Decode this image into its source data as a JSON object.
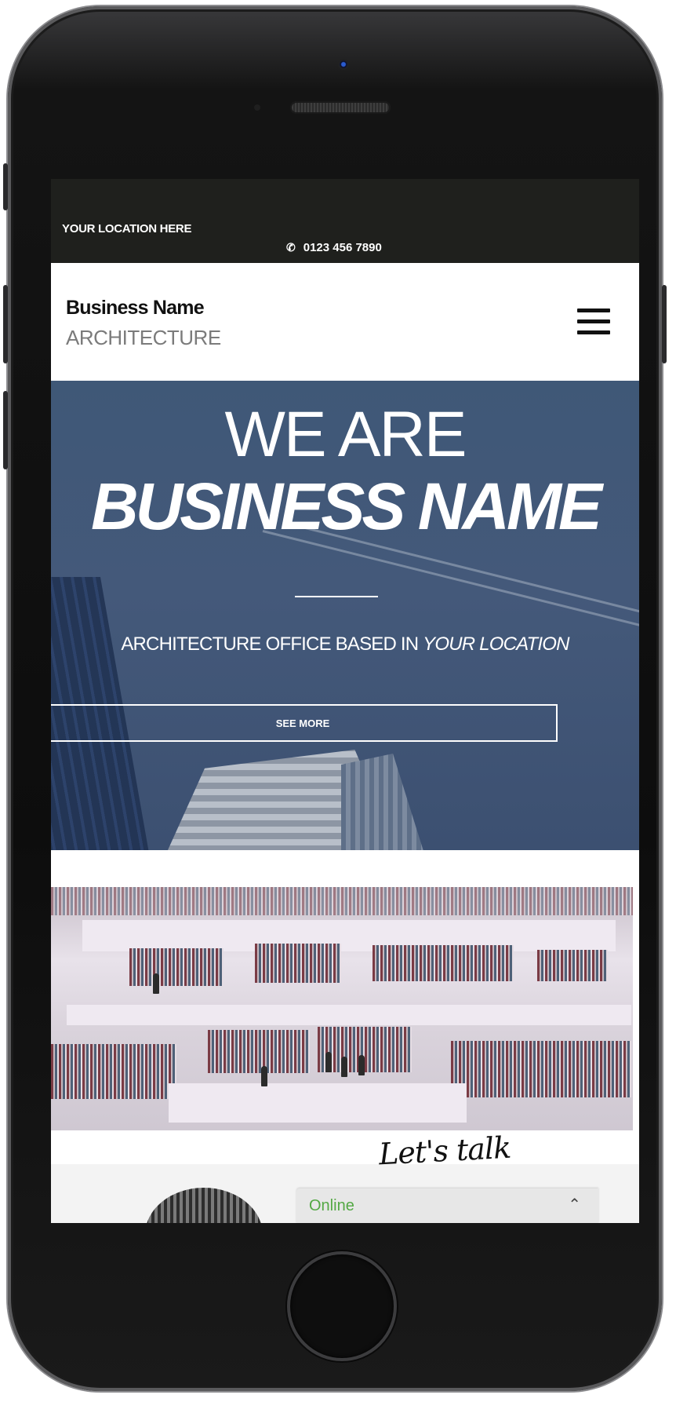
{
  "topbar": {
    "location": "YOUR LOCATION HERE",
    "phone_icon": "phone-icon",
    "phone": "0123 456 7890"
  },
  "header": {
    "brand_name": "Business Name",
    "brand_sub": "ARCHITECTURE",
    "menu_icon": "hamburger-menu-icon"
  },
  "hero": {
    "line1": "WE ARE",
    "line2": "BUSINESS NAME",
    "tagline_prefix": "ARCHITECTURE OFFICE BASED IN ",
    "tagline_location": "YOUR LOCATION",
    "button_label": "SEE MORE"
  },
  "chat": {
    "lets_talk": "Let's talk",
    "status": "Online",
    "toggle_icon": "chevron-up-icon"
  },
  "colors": {
    "topbar_bg": "#1f201d",
    "hero_bg": "#44597a",
    "online_green": "#53a844"
  }
}
